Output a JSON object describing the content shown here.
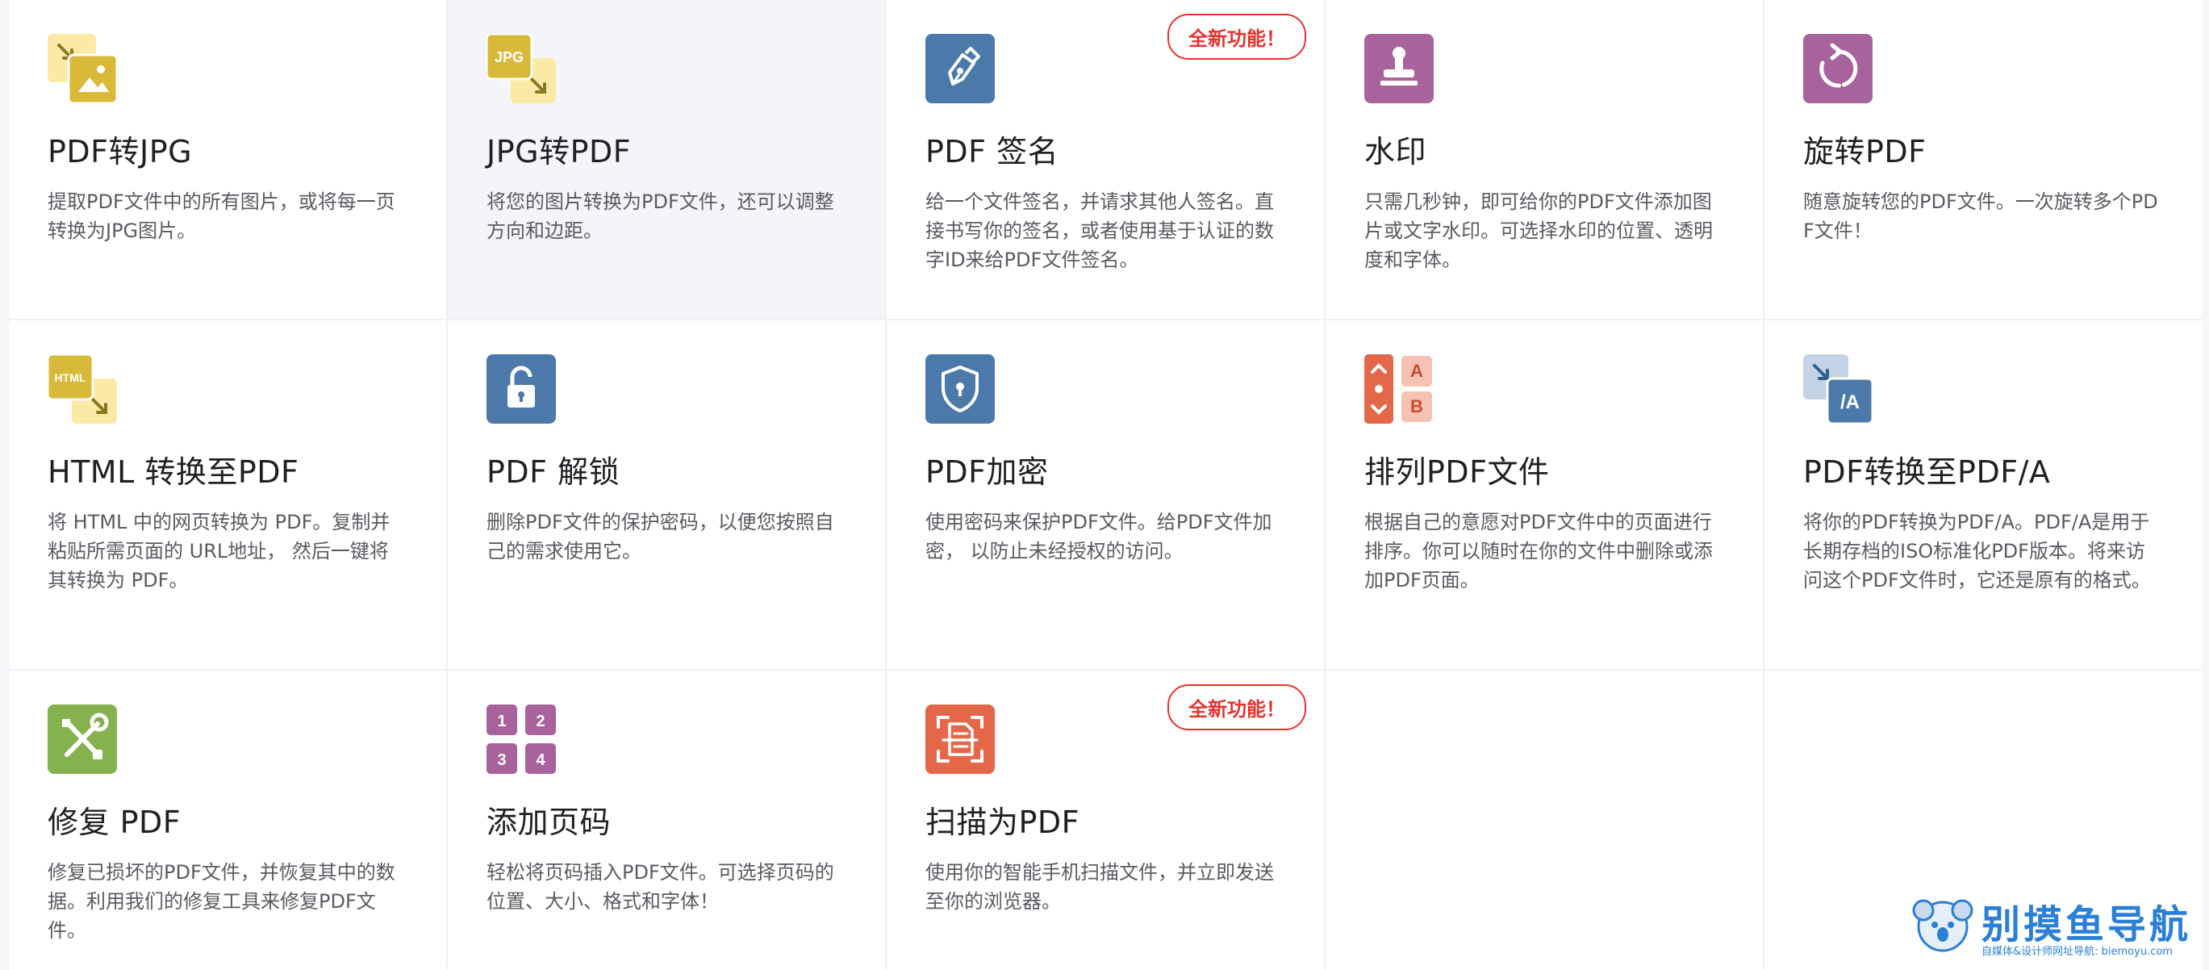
{
  "tools": [
    {
      "title": "PDF转JPG",
      "desc": "提取PDF文件中的所有图片，或将每一页转换为JPG图片。",
      "icon": "pdf-to-jpg-icon"
    },
    {
      "title": "JPG转PDF",
      "desc": "将您的图片转换为PDF文件，还可以调整方向和边距。",
      "icon": "jpg-to-pdf-icon",
      "icon_label": "JPG"
    },
    {
      "title": "PDF 签名",
      "desc": "给一个文件签名，并请求其他人签名。直接书写你的签名，或者使用基于认证的数字ID来给PDF文件签名。",
      "icon": "pen-nib-icon",
      "badge": "全新功能！"
    },
    {
      "title": "水印",
      "desc": "只需几秒钟，即可给你的PDF文件添加图片或文字水印。可选择水印的位置、透明度和字体。",
      "icon": "stamp-icon"
    },
    {
      "title": "旋转PDF",
      "desc": "随意旋转您的PDF文件。一次旋转多个PDF文件！",
      "icon": "rotate-icon"
    },
    {
      "title": "HTML 转换至PDF",
      "desc": "将 HTML 中的网页转换为 PDF。复制并粘贴所需页面的 URL地址， 然后一键将其转换为 PDF。",
      "icon": "html-to-pdf-icon",
      "icon_label": "HTML"
    },
    {
      "title": "PDF 解锁",
      "desc": "删除PDF文件的保护密码，以便您按照自己的需求使用它。",
      "icon": "unlock-icon"
    },
    {
      "title": "PDF加密",
      "desc": "使用密码来保护PDF文件。给PDF文件加密， 以防止未经授权的访问。",
      "icon": "shield-lock-icon"
    },
    {
      "title": "排列PDF文件",
      "desc": "根据自己的意愿对PDF文件中的页面进行排序。你可以随时在你的文件中删除或添加PDF页面。",
      "icon": "organize-pages-icon",
      "icon_labels": [
        "A",
        "B"
      ]
    },
    {
      "title": "PDF转换至PDF/A",
      "desc": "将你的PDF转换为PDF/A。PDF/A是用于长期存档的ISO标准化PDF版本。将来访问这个PDF文件时，它还是原有的格式。",
      "icon": "pdf-to-pdfa-icon",
      "icon_label": "/A"
    },
    {
      "title": "修复 PDF",
      "desc": "修复已损坏的PDF文件，并恢复其中的数据。利用我们的修复工具来修复PDF文件。",
      "icon": "repair-tools-icon"
    },
    {
      "title": "添加页码",
      "desc": "轻松将页码插入PDF文件。可选择页码的位置、大小、格式和字体！",
      "icon": "page-numbers-icon",
      "icon_labels": [
        "1",
        "2",
        "3",
        "4"
      ]
    },
    {
      "title": "扫描为PDF",
      "desc": "使用你的智能手机扫描文件，并立即发送至你的浏览器。",
      "icon": "scan-document-icon",
      "badge": "全新功能！"
    }
  ],
  "watermark": {
    "text": "别摸鱼导航",
    "subtext": "自媒体&设计师网址导航: biemoyu.com"
  },
  "colors": {
    "yellow": "#d9b93a",
    "yellow_light": "#fbe9a6",
    "blue": "#4a79aa",
    "purple": "#a8639c",
    "orange": "#e5674a",
    "green": "#85b24f",
    "badge_red": "#e5322d"
  }
}
